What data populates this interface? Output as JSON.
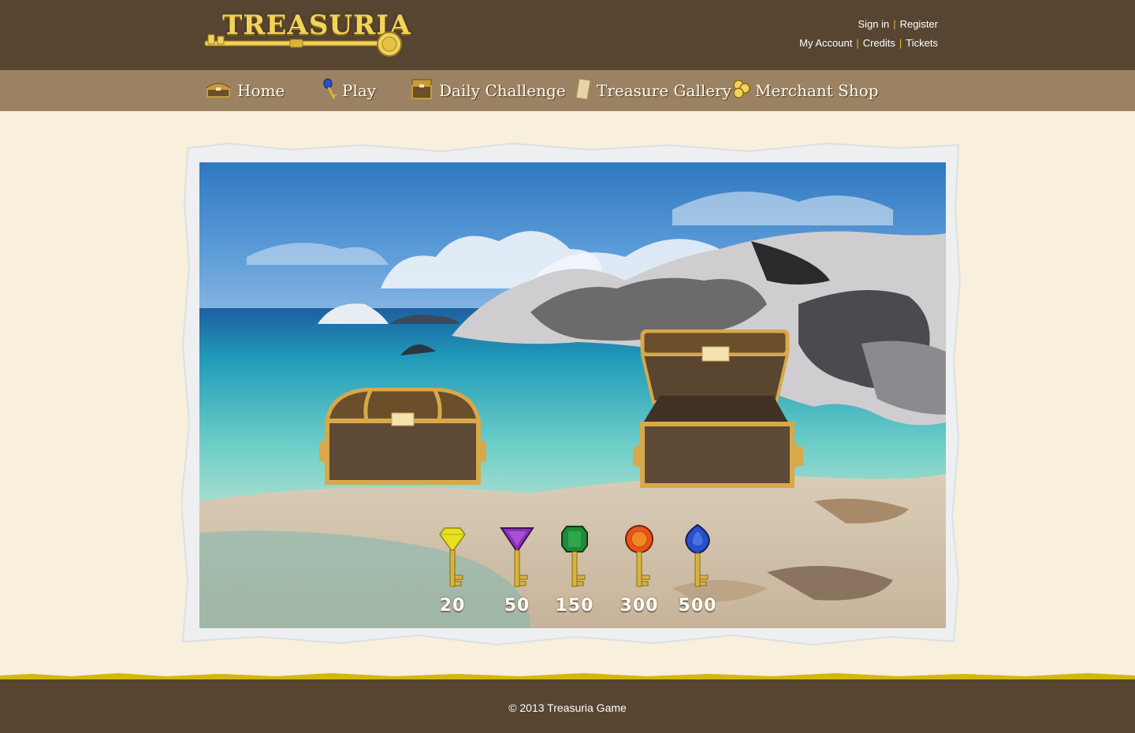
{
  "header": {
    "logo_text": "TREASURIA",
    "links_row1": [
      "Sign in",
      "Register"
    ],
    "links_row2": [
      "My Account",
      "Credits",
      "Tickets"
    ]
  },
  "nav": {
    "items": [
      {
        "label": "Home",
        "icon": "treasure-chest-icon"
      },
      {
        "label": "Play",
        "icon": "key-icon"
      },
      {
        "label": "Daily Challenge",
        "icon": "chest-stack-icon"
      },
      {
        "label": "Treasure Gallery",
        "icon": "scroll-icon"
      },
      {
        "label": "Merchant Shop",
        "icon": "coins-icon"
      }
    ]
  },
  "game": {
    "chests": [
      {
        "state": "closed"
      },
      {
        "state": "open"
      }
    ],
    "keys": [
      {
        "value": "20",
        "gem_color": "#e8e020",
        "gem": "yellow-diamond"
      },
      {
        "value": "50",
        "gem_color": "#8a2fb8",
        "gem": "purple-triangle"
      },
      {
        "value": "150",
        "gem_color": "#1f8a3a",
        "gem": "green-emerald"
      },
      {
        "value": "300",
        "gem_color": "#e8541c",
        "gem": "orange-round"
      },
      {
        "value": "500",
        "gem_color": "#2a4fc8",
        "gem": "blue-drop"
      }
    ]
  },
  "footer": {
    "copyright": "© 2013 Treasuria Game"
  },
  "colors": {
    "header_bg": "#574532",
    "nav_bg": "#9b8262",
    "page_bg": "#f8efdd",
    "accent_gold": "#e6b93a",
    "footer_strip": "#d4b610"
  }
}
